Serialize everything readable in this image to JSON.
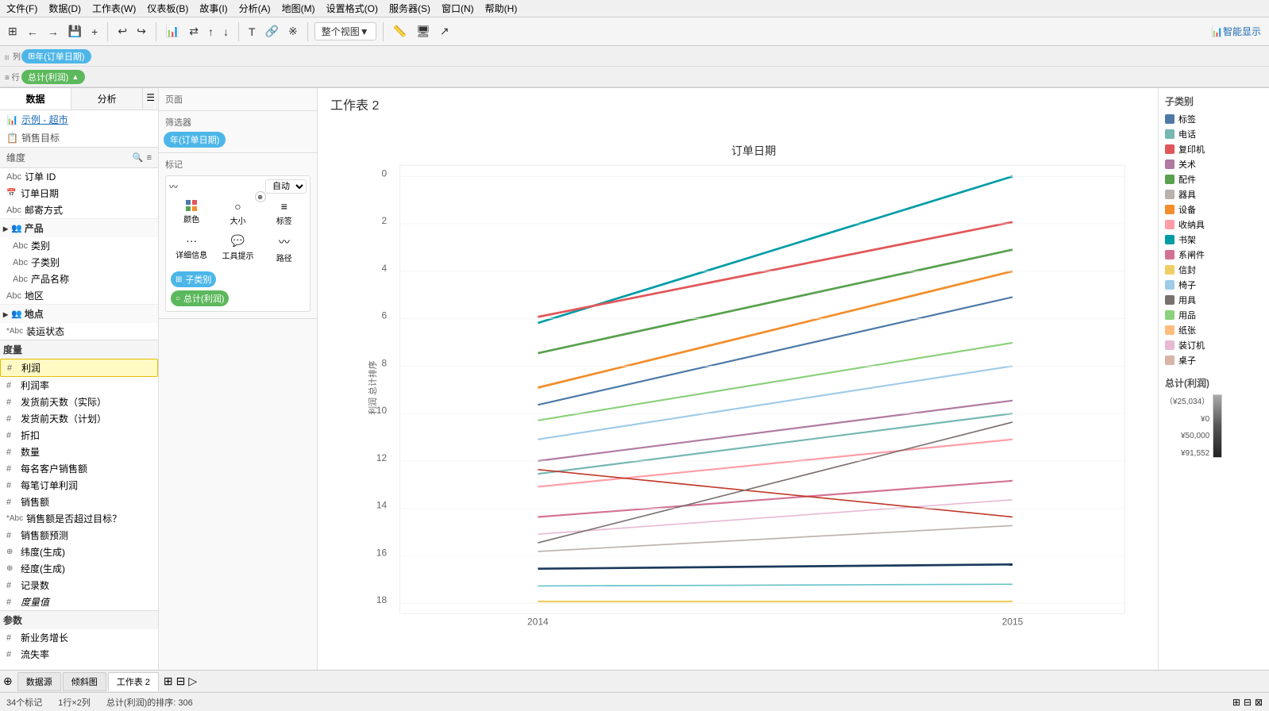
{
  "menubar": {
    "items": [
      "文件(F)",
      "数据(D)",
      "工作表(W)",
      "仪表板(B)",
      "故事(I)",
      "分析(A)",
      "地图(M)",
      "设置格式(O)",
      "服务器(S)",
      "窗口(N)",
      "帮助(H)"
    ]
  },
  "toolbar": {
    "smart_display": "智能显示",
    "view_label": "整个视图"
  },
  "panel": {
    "data_tab": "数据",
    "analysis_tab": "分析",
    "data_sources": [
      {
        "icon": "📊",
        "name": "示例 - 超市"
      },
      {
        "icon": "📋",
        "name": "销售目标"
      }
    ]
  },
  "dimensions": {
    "header": "维度",
    "fields": [
      {
        "type": "Abc",
        "name": "订单 ID",
        "indent": false
      },
      {
        "type": "📅",
        "name": "订单日期",
        "indent": false
      },
      {
        "type": "Abc",
        "name": "邮寄方式",
        "indent": false
      },
      {
        "type": "group",
        "name": "产品",
        "indent": false
      },
      {
        "type": "Abc",
        "name": "类别",
        "indent": true
      },
      {
        "type": "Abc",
        "name": "子类别",
        "indent": true
      },
      {
        "type": "Abc",
        "name": "产品名称",
        "indent": true
      },
      {
        "type": "Abc",
        "name": "地区",
        "indent": false
      },
      {
        "type": "group",
        "name": "地点",
        "indent": false
      },
      {
        "type": "*Abc",
        "name": "装运状态",
        "indent": false
      }
    ]
  },
  "measures": {
    "header": "度量",
    "fields": [
      {
        "type": "#",
        "name": "利润",
        "highlighted": true
      },
      {
        "type": "#",
        "name": "利润率",
        "indent": false
      },
      {
        "type": "#",
        "name": "发货前天数（实际）",
        "indent": false
      },
      {
        "type": "#",
        "name": "发货前天数（计划）",
        "indent": false
      },
      {
        "type": "#",
        "name": "折扣",
        "indent": false
      },
      {
        "type": "#",
        "name": "数量",
        "indent": false
      },
      {
        "type": "#",
        "name": "每名客户销售额",
        "indent": false
      },
      {
        "type": "#",
        "name": "每笔订单利润",
        "indent": false
      },
      {
        "type": "#",
        "name": "销售额",
        "indent": false
      },
      {
        "type": "*Abc",
        "name": "销售额是否超过目标？",
        "indent": false
      },
      {
        "type": "#",
        "name": "销售额预测",
        "indent": false
      },
      {
        "type": "⊕",
        "name": "纬度(生成)",
        "indent": false
      },
      {
        "type": "⊕",
        "name": "经度(生成)",
        "indent": false
      },
      {
        "type": "#",
        "name": "记录数",
        "indent": false
      },
      {
        "type": "#",
        "name": "度量值",
        "italic": true,
        "indent": false
      }
    ]
  },
  "params": {
    "header": "参数",
    "fields": [
      {
        "type": "#",
        "name": "新业务增长"
      },
      {
        "type": "#",
        "name": "流失率"
      }
    ]
  },
  "pages": {
    "header": "页面"
  },
  "filters": {
    "header": "筛选器",
    "items": [
      "年(订单日期)"
    ]
  },
  "marks": {
    "header": "标记",
    "type": "自动",
    "buttons": [
      {
        "icon": "⬛⬛",
        "label": "颜色"
      },
      {
        "icon": "○",
        "label": "大小"
      },
      {
        "icon": "≡",
        "label": "标签"
      },
      {
        "icon": "···",
        "label": "详细信息"
      },
      {
        "icon": "💬",
        "label": "工具提示"
      },
      {
        "icon": "〰",
        "label": "路径"
      }
    ],
    "pills": [
      {
        "icon": "⊞",
        "name": "子类别",
        "color": "blue"
      },
      {
        "icon": "○",
        "name": "总计(利润)",
        "color": "green"
      }
    ]
  },
  "shelves": {
    "columns_label": "列",
    "columns_pills": [
      {
        "name": "年(订单日期)",
        "color": "blue"
      }
    ],
    "rows_label": "行",
    "rows_pills": [
      {
        "name": "总计(利润)",
        "color": "green",
        "triangle": true
      }
    ]
  },
  "chart": {
    "title": "工作表 2",
    "x_axis_label": "订单日期",
    "y_axis_label": "利润 总计排序",
    "x_ticks": [
      "2014",
      "2015"
    ],
    "y_ticks": [
      "0",
      "2",
      "4",
      "6",
      "8",
      "10",
      "12",
      "14",
      "16",
      "18"
    ]
  },
  "legend": {
    "category_title": "子类别",
    "items": [
      {
        "name": "标签",
        "color": "#4e79a7"
      },
      {
        "name": "电话",
        "color": "#76b7b2"
      },
      {
        "name": "复印机",
        "color": "#e15759"
      },
      {
        "name": "关术",
        "color": "#b07aa1"
      },
      {
        "name": "配件",
        "color": "#59a14f"
      },
      {
        "name": "器具",
        "color": "#bab0ac"
      },
      {
        "name": "设备",
        "color": "#f28e2b"
      },
      {
        "name": "收纳具",
        "color": "#ff9da7"
      },
      {
        "name": "书架",
        "color": "#009ca6"
      },
      {
        "name": "系闸件",
        "color": "#d37295"
      },
      {
        "name": "信封",
        "color": "#f1ce63"
      },
      {
        "name": "椅子",
        "color": "#a0cbe8"
      },
      {
        "name": "用具",
        "color": "#79706e"
      },
      {
        "name": "用品",
        "color": "#8cd17d"
      },
      {
        "name": "纸张",
        "color": "#ffbe7d"
      },
      {
        "name": "装订机",
        "color": "#e8b9d5"
      },
      {
        "name": "桌子",
        "color": "#d7b5a6"
      }
    ],
    "measure_title": "总计(利润)",
    "measure_values": [
      {
        "label": "（¥25,034）",
        "pos": "top"
      },
      {
        "label": "¥0",
        "pos": "mid-top"
      },
      {
        "label": "¥50,000",
        "pos": "mid-bot"
      },
      {
        "label": "¥91,552",
        "pos": "bottom"
      }
    ]
  },
  "bottom_tabs": [
    {
      "name": "数据源",
      "active": false
    },
    {
      "name": "倾斜图",
      "active": false
    },
    {
      "name": "工作表 2",
      "active": true
    }
  ],
  "status_bar": {
    "marks": "34个标记",
    "rows": "1行×2列",
    "sort": "总计(利润)的排序: 306"
  }
}
